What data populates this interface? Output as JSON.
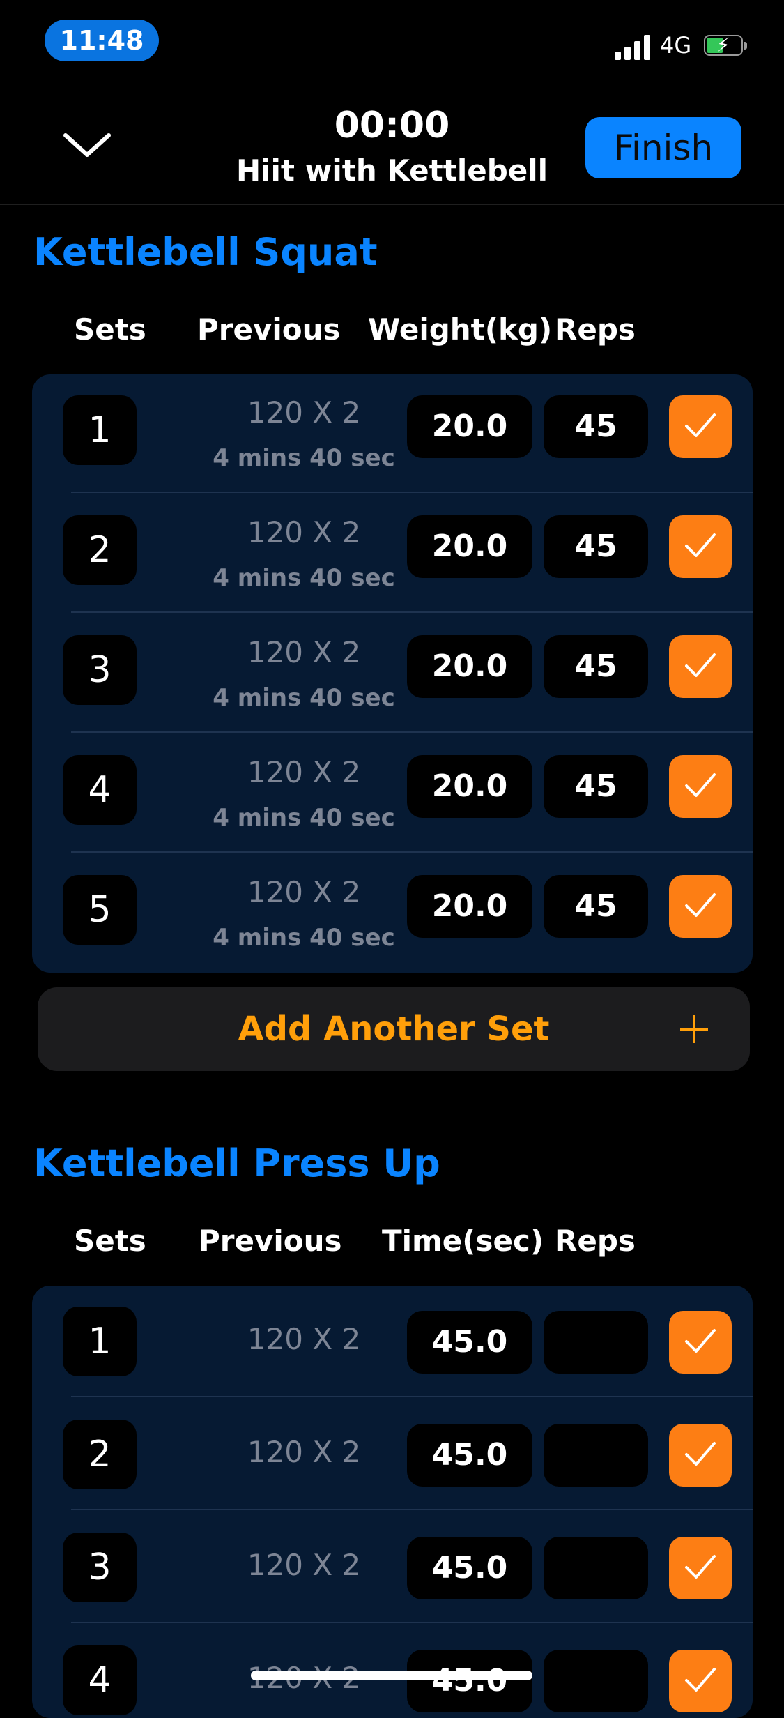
{
  "status_bar": {
    "time": "11:48",
    "network": "4G",
    "battery_level": 0.45,
    "battery_charging": true
  },
  "header": {
    "elapsed": "00:00",
    "workout_name": "Hiit with Kettlebell",
    "finish_label": "Finish",
    "collapse_icon": "chevron-down-icon"
  },
  "exercises": [
    {
      "title": "Kettlebell Squat",
      "columns": [
        "Sets",
        "Previous",
        "Weight(kg)",
        "Reps"
      ],
      "sets": [
        {
          "set": "1",
          "previous": "120 X 2",
          "previous_time": "4 mins 40 sec",
          "value": "20.0",
          "reps": "45",
          "done": true
        },
        {
          "set": "2",
          "previous": "120 X 2",
          "previous_time": "4 mins 40 sec",
          "value": "20.0",
          "reps": "45",
          "done": true
        },
        {
          "set": "3",
          "previous": "120 X 2",
          "previous_time": "4 mins 40 sec",
          "value": "20.0",
          "reps": "45",
          "done": true
        },
        {
          "set": "4",
          "previous": "120 X 2",
          "previous_time": "4 mins 40 sec",
          "value": "20.0",
          "reps": "45",
          "done": true
        },
        {
          "set": "5",
          "previous": "120 X 2",
          "previous_time": "4 mins 40 sec",
          "value": "20.0",
          "reps": "45",
          "done": true
        }
      ],
      "add_set_label": "Add Another Set"
    },
    {
      "title": "Kettlebell Press Up",
      "columns": [
        "Sets",
        "Previous",
        "Time(sec)",
        "Reps"
      ],
      "sets": [
        {
          "set": "1",
          "previous": "120 X 2",
          "value": "45.0",
          "reps": "",
          "done": true
        },
        {
          "set": "2",
          "previous": "120 X 2",
          "value": "45.0",
          "reps": "",
          "done": true
        },
        {
          "set": "3",
          "previous": "120 X 2",
          "value": "45.0",
          "reps": "",
          "done": true
        },
        {
          "set": "4",
          "previous": "120 X 2",
          "value": "45.0",
          "reps": "",
          "done": true
        }
      ]
    }
  ],
  "colors": {
    "accent_blue": "#0a84ff",
    "accent_orange": "#fd7e14",
    "card_bg": "#061a33"
  }
}
